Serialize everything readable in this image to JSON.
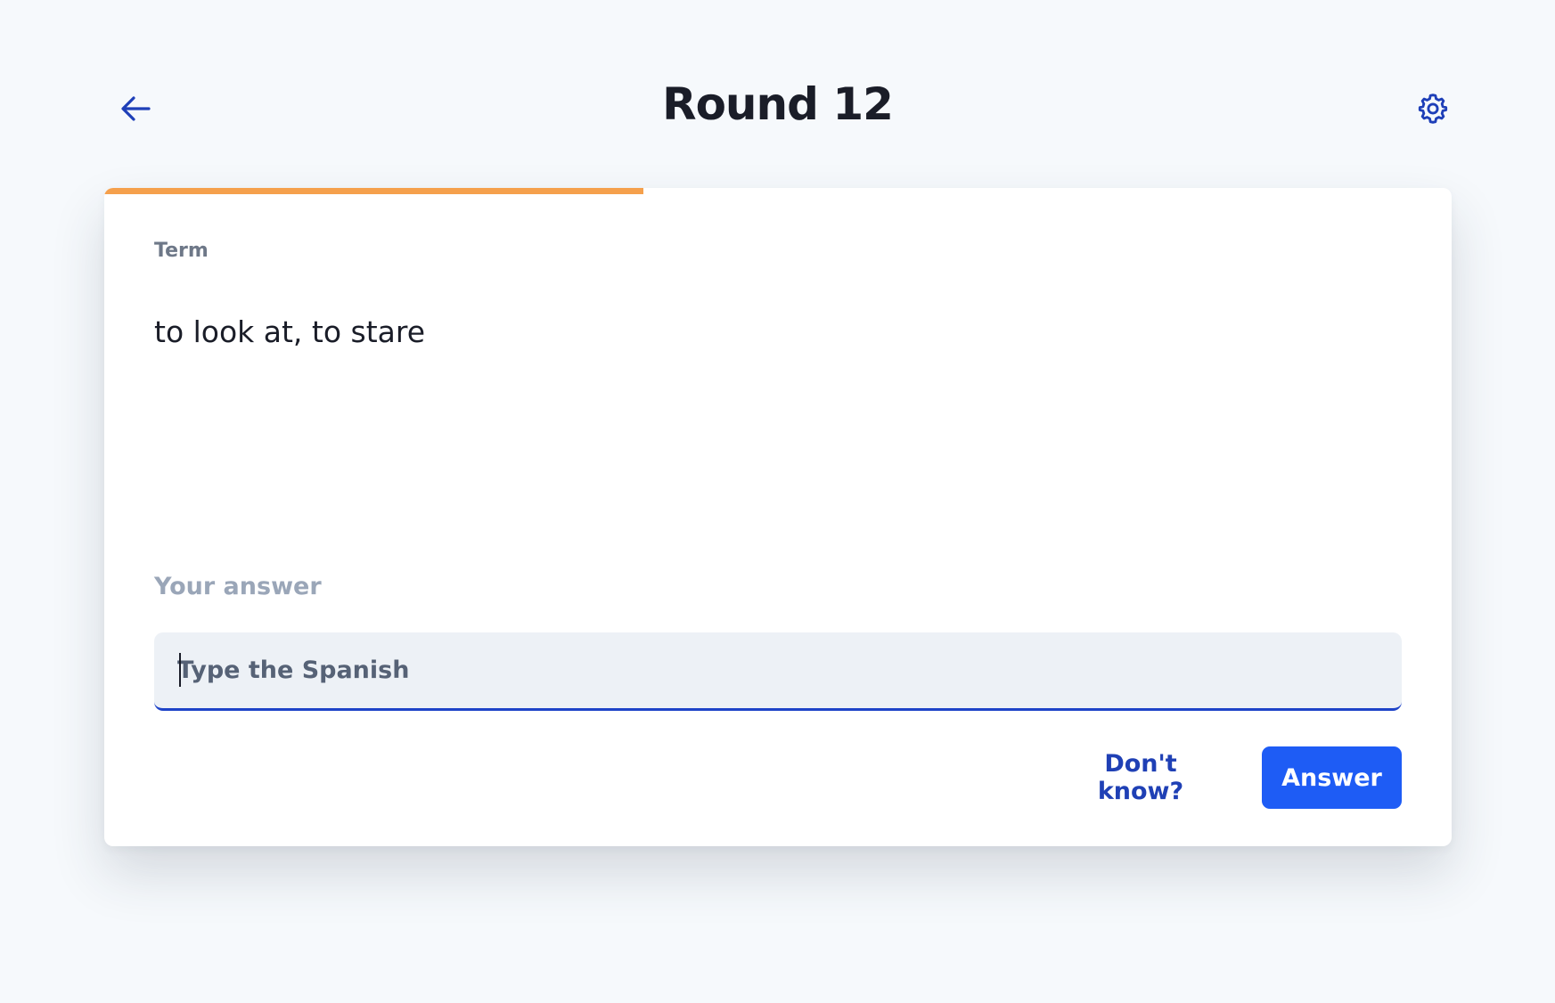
{
  "header": {
    "title": "Round 12",
    "back_icon": "arrow-left-icon",
    "settings_icon": "gear-icon"
  },
  "progress": {
    "fraction": 0.4
  },
  "card": {
    "term_label": "Term",
    "term_text": "to look at, to stare",
    "answer_label": "Your answer",
    "answer_placeholder": "Type the Spanish",
    "answer_value": "",
    "dont_know_label": "Don't know?",
    "answer_button_label": "Answer"
  },
  "colors": {
    "background": "#f6f9fc",
    "progress": "#f5a04c",
    "accent": "#1e5cf5",
    "link": "#1f40b5",
    "title": "#1a1d28"
  }
}
